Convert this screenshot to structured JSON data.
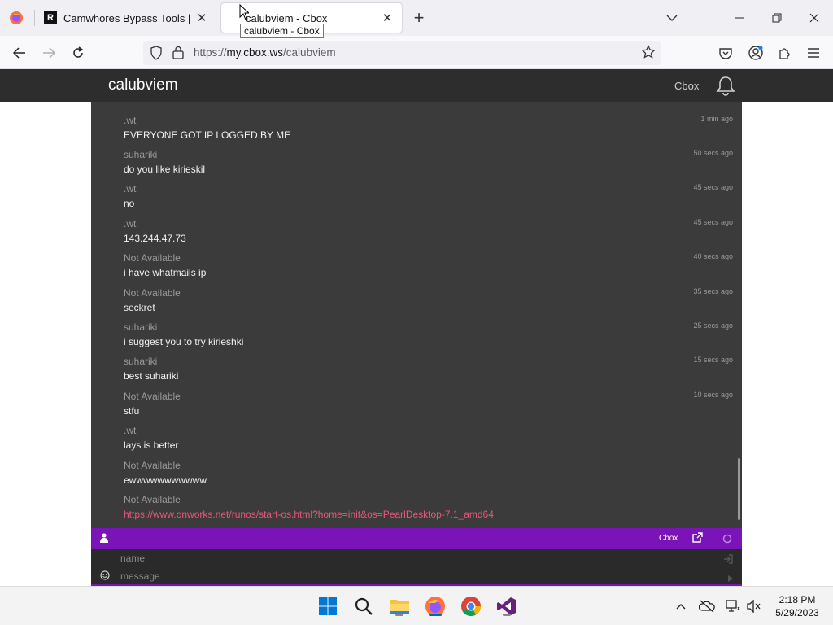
{
  "browser": {
    "tabs": [
      {
        "title": "Camwhores Bypass Tools | Priva",
        "favicon": "R",
        "active": false
      },
      {
        "title": "calubviem - Cbox",
        "active": true
      }
    ],
    "tooltip": "calubviem - Cbox",
    "url": {
      "scheme": "https://",
      "host": "my.cbox.ws",
      "path": "/calubviem"
    }
  },
  "site": {
    "title": "calubviem",
    "nav_link": "Cbox",
    "accent": "#7a14b8",
    "link_color": "#e8587a"
  },
  "messages": [
    {
      "name": ".wt",
      "text": "EVERYONE GOT IP LOGGED BY ME",
      "time": "1 min ago"
    },
    {
      "name": "suhariki",
      "text": "do you like kirieskil",
      "time": "50 secs ago"
    },
    {
      "name": ".wt",
      "text": "no",
      "time": "45 secs ago"
    },
    {
      "name": ".wt",
      "text": "143.244.47.73",
      "time": "45 secs ago"
    },
    {
      "name": "Not Available",
      "text": "i have whatmails ip",
      "time": "40 secs ago"
    },
    {
      "name": "Not Available",
      "text": "seckret",
      "time": "35 secs ago"
    },
    {
      "name": "suhariki",
      "text": "i suggest you to try kirieshki",
      "time": "25 secs ago"
    },
    {
      "name": "suhariki",
      "text": "best suhariki",
      "time": "15 secs ago"
    },
    {
      "name": "Not Available",
      "text": "stfu",
      "time": "10 secs ago"
    },
    {
      "name": ".wt",
      "text": "lays is better",
      "time": ""
    },
    {
      "name": "Not Available",
      "text": "ewwwwwwwwwww",
      "time": ""
    },
    {
      "name": "Not Available",
      "text": "https://www.onworks.net/runos/start-os.html?home=init&os=PearlDesktop-7.1_amd64",
      "time": "",
      "is_link": true
    }
  ],
  "chat_toolbar": {
    "cbox_label": "Cbox"
  },
  "form": {
    "name_placeholder": "name",
    "message_placeholder": "message"
  },
  "taskbar": {
    "apps": [
      "windows-start-icon",
      "search-icon",
      "file-explorer-icon",
      "firefox-icon",
      "chrome-icon",
      "visual-studio-icon"
    ],
    "time": "2:18 PM",
    "date": "5/29/2023"
  }
}
